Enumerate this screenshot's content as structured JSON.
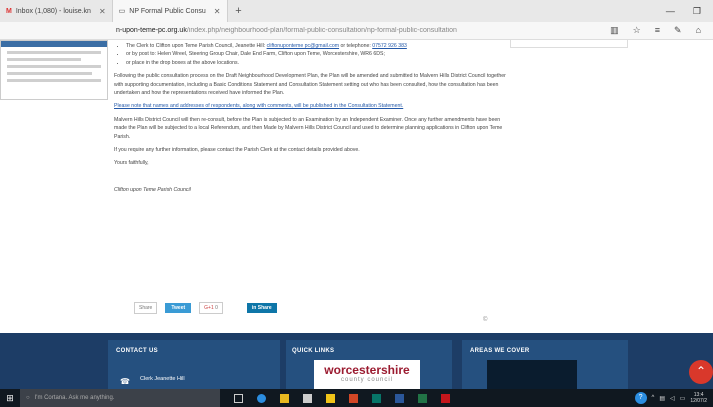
{
  "browser": {
    "tabs": [
      {
        "label": "Inbox (1,080) - louise.kn",
        "icon": "gmail-icon"
      },
      {
        "label": "NP Formal Public Consu",
        "icon": "page-icon"
      }
    ],
    "new_tab": "+",
    "url_host": "n-upon-teme-pc.org.uk",
    "url_path": "/index.php/neighbourhood-plan/formal-public-consultation/np-formal-public-consultation"
  },
  "content": {
    "bullet1_pre": "The Clerk to Clifton upon Teme Parish Council, Jeanette Hill: ",
    "bullet1_email": "cliftonuponteme pc@gmail.com",
    "bullet1_mid": " or telephone: ",
    "bullet1_phone": "07572 926 383",
    "bullet2": "or by post to: Helen Wreel, Steering Group Chair, Dale End Farm, Clifton upon Teme, Worcestershire, WR6 6DS;",
    "bullet3": "or place in the drop boxes at the above locations.",
    "para1": "Following the public consultation process on the Draft Neighbourhood Development Plan, the Plan will be amended and submitted to Malvern Hills District Council together with supporting documentation, including a Basic Conditions Statement and Consultation Statement setting out who has been consulted, how the consultation has been undertaken and how the representations received have informed the Plan.",
    "para2": "Please note that names and addresses of respondents, along with comments, will be published in the Consultation Statement.",
    "para3": "Malvern Hills District Council will then re-consult, before the Plan is subjected to an Examination by an Independent Examiner. Once any further amendments have been made the Plan will be subjected to a local Referendum, and then Made by Malvern Hills District Council and used to determine planning applications in Clifton upon Teme Parish.",
    "para4": "If you require any further information, please contact the Parish Clerk at the contact details provided above.",
    "para5": "Yours faithfully,",
    "signature": "Clifton upon Teme Parish Council"
  },
  "share": {
    "share_label": "Share",
    "tweet_label": "Tweet",
    "gplus_label": "G+1",
    "gplus_count": "0",
    "linkedin_label": "in Share"
  },
  "copyright": "©",
  "footer": {
    "contact_title": "CONTACT US",
    "quick_links_title": "QUICK LINKS",
    "areas_title": "AREAS WE COVER",
    "clerk_name": "Clerk Jeanette Hill",
    "worcs_line1": "worcestershire",
    "worcs_line2": "county council"
  },
  "taskbar": {
    "search_placeholder": "I'm Cortana. Ask me anything.",
    "time": "13:4",
    "date": "12/07/2"
  }
}
